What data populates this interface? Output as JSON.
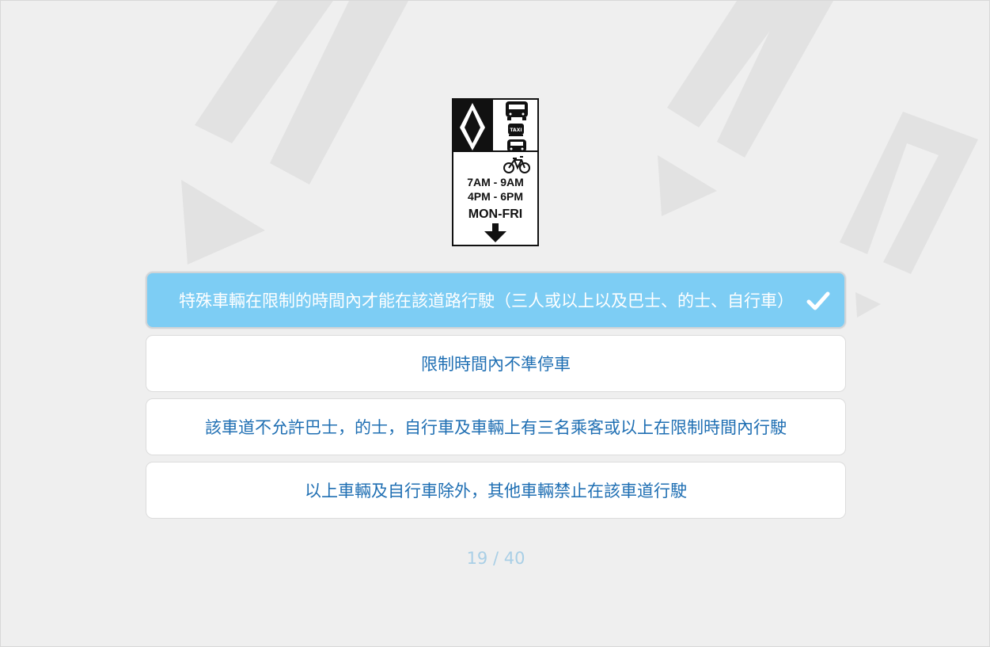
{
  "question": {
    "sign": {
      "icon": "hov-lane-sign",
      "times": [
        "7AM - 9AM",
        "4PM - 6PM"
      ],
      "days": "MON-FRI",
      "taxi_label": "TAXI"
    }
  },
  "options": [
    {
      "label": "特殊車輛在限制的時間內才能在該道路行駛（三人或以上以及巴士、的士、自行車）",
      "selected": true
    },
    {
      "label": "限制時間內不準停車",
      "selected": false
    },
    {
      "label": "該車道不允許巴士，的士，自行車及車輛上有三名乘客或以上在限制時間內行駛",
      "selected": false
    },
    {
      "label": "以上車輛及自行車除外，其他車輛禁止在該車道行駛",
      "selected": false
    }
  ],
  "progress": "19 / 40",
  "colors": {
    "background": "#efefef",
    "selected_fill": "#7dcdf4",
    "option_text": "#1f6fb3",
    "progress_text": "#a9cfe6"
  }
}
